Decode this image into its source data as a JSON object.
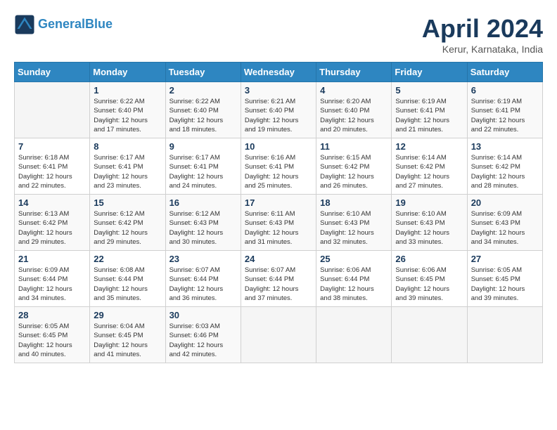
{
  "header": {
    "logo_line1": "General",
    "logo_line2": "Blue",
    "month_title": "April 2024",
    "subtitle": "Kerur, Karnataka, India"
  },
  "days_of_week": [
    "Sunday",
    "Monday",
    "Tuesday",
    "Wednesday",
    "Thursday",
    "Friday",
    "Saturday"
  ],
  "weeks": [
    [
      {
        "day": "",
        "info": ""
      },
      {
        "day": "1",
        "info": "Sunrise: 6:22 AM\nSunset: 6:40 PM\nDaylight: 12 hours\nand 17 minutes."
      },
      {
        "day": "2",
        "info": "Sunrise: 6:22 AM\nSunset: 6:40 PM\nDaylight: 12 hours\nand 18 minutes."
      },
      {
        "day": "3",
        "info": "Sunrise: 6:21 AM\nSunset: 6:40 PM\nDaylight: 12 hours\nand 19 minutes."
      },
      {
        "day": "4",
        "info": "Sunrise: 6:20 AM\nSunset: 6:40 PM\nDaylight: 12 hours\nand 20 minutes."
      },
      {
        "day": "5",
        "info": "Sunrise: 6:19 AM\nSunset: 6:41 PM\nDaylight: 12 hours\nand 21 minutes."
      },
      {
        "day": "6",
        "info": "Sunrise: 6:19 AM\nSunset: 6:41 PM\nDaylight: 12 hours\nand 22 minutes."
      }
    ],
    [
      {
        "day": "7",
        "info": "Sunrise: 6:18 AM\nSunset: 6:41 PM\nDaylight: 12 hours\nand 22 minutes."
      },
      {
        "day": "8",
        "info": "Sunrise: 6:17 AM\nSunset: 6:41 PM\nDaylight: 12 hours\nand 23 minutes."
      },
      {
        "day": "9",
        "info": "Sunrise: 6:17 AM\nSunset: 6:41 PM\nDaylight: 12 hours\nand 24 minutes."
      },
      {
        "day": "10",
        "info": "Sunrise: 6:16 AM\nSunset: 6:41 PM\nDaylight: 12 hours\nand 25 minutes."
      },
      {
        "day": "11",
        "info": "Sunrise: 6:15 AM\nSunset: 6:42 PM\nDaylight: 12 hours\nand 26 minutes."
      },
      {
        "day": "12",
        "info": "Sunrise: 6:14 AM\nSunset: 6:42 PM\nDaylight: 12 hours\nand 27 minutes."
      },
      {
        "day": "13",
        "info": "Sunrise: 6:14 AM\nSunset: 6:42 PM\nDaylight: 12 hours\nand 28 minutes."
      }
    ],
    [
      {
        "day": "14",
        "info": "Sunrise: 6:13 AM\nSunset: 6:42 PM\nDaylight: 12 hours\nand 29 minutes."
      },
      {
        "day": "15",
        "info": "Sunrise: 6:12 AM\nSunset: 6:42 PM\nDaylight: 12 hours\nand 29 minutes."
      },
      {
        "day": "16",
        "info": "Sunrise: 6:12 AM\nSunset: 6:43 PM\nDaylight: 12 hours\nand 30 minutes."
      },
      {
        "day": "17",
        "info": "Sunrise: 6:11 AM\nSunset: 6:43 PM\nDaylight: 12 hours\nand 31 minutes."
      },
      {
        "day": "18",
        "info": "Sunrise: 6:10 AM\nSunset: 6:43 PM\nDaylight: 12 hours\nand 32 minutes."
      },
      {
        "day": "19",
        "info": "Sunrise: 6:10 AM\nSunset: 6:43 PM\nDaylight: 12 hours\nand 33 minutes."
      },
      {
        "day": "20",
        "info": "Sunrise: 6:09 AM\nSunset: 6:43 PM\nDaylight: 12 hours\nand 34 minutes."
      }
    ],
    [
      {
        "day": "21",
        "info": "Sunrise: 6:09 AM\nSunset: 6:44 PM\nDaylight: 12 hours\nand 34 minutes."
      },
      {
        "day": "22",
        "info": "Sunrise: 6:08 AM\nSunset: 6:44 PM\nDaylight: 12 hours\nand 35 minutes."
      },
      {
        "day": "23",
        "info": "Sunrise: 6:07 AM\nSunset: 6:44 PM\nDaylight: 12 hours\nand 36 minutes."
      },
      {
        "day": "24",
        "info": "Sunrise: 6:07 AM\nSunset: 6:44 PM\nDaylight: 12 hours\nand 37 minutes."
      },
      {
        "day": "25",
        "info": "Sunrise: 6:06 AM\nSunset: 6:44 PM\nDaylight: 12 hours\nand 38 minutes."
      },
      {
        "day": "26",
        "info": "Sunrise: 6:06 AM\nSunset: 6:45 PM\nDaylight: 12 hours\nand 39 minutes."
      },
      {
        "day": "27",
        "info": "Sunrise: 6:05 AM\nSunset: 6:45 PM\nDaylight: 12 hours\nand 39 minutes."
      }
    ],
    [
      {
        "day": "28",
        "info": "Sunrise: 6:05 AM\nSunset: 6:45 PM\nDaylight: 12 hours\nand 40 minutes."
      },
      {
        "day": "29",
        "info": "Sunrise: 6:04 AM\nSunset: 6:45 PM\nDaylight: 12 hours\nand 41 minutes."
      },
      {
        "day": "30",
        "info": "Sunrise: 6:03 AM\nSunset: 6:46 PM\nDaylight: 12 hours\nand 42 minutes."
      },
      {
        "day": "",
        "info": ""
      },
      {
        "day": "",
        "info": ""
      },
      {
        "day": "",
        "info": ""
      },
      {
        "day": "",
        "info": ""
      }
    ]
  ]
}
